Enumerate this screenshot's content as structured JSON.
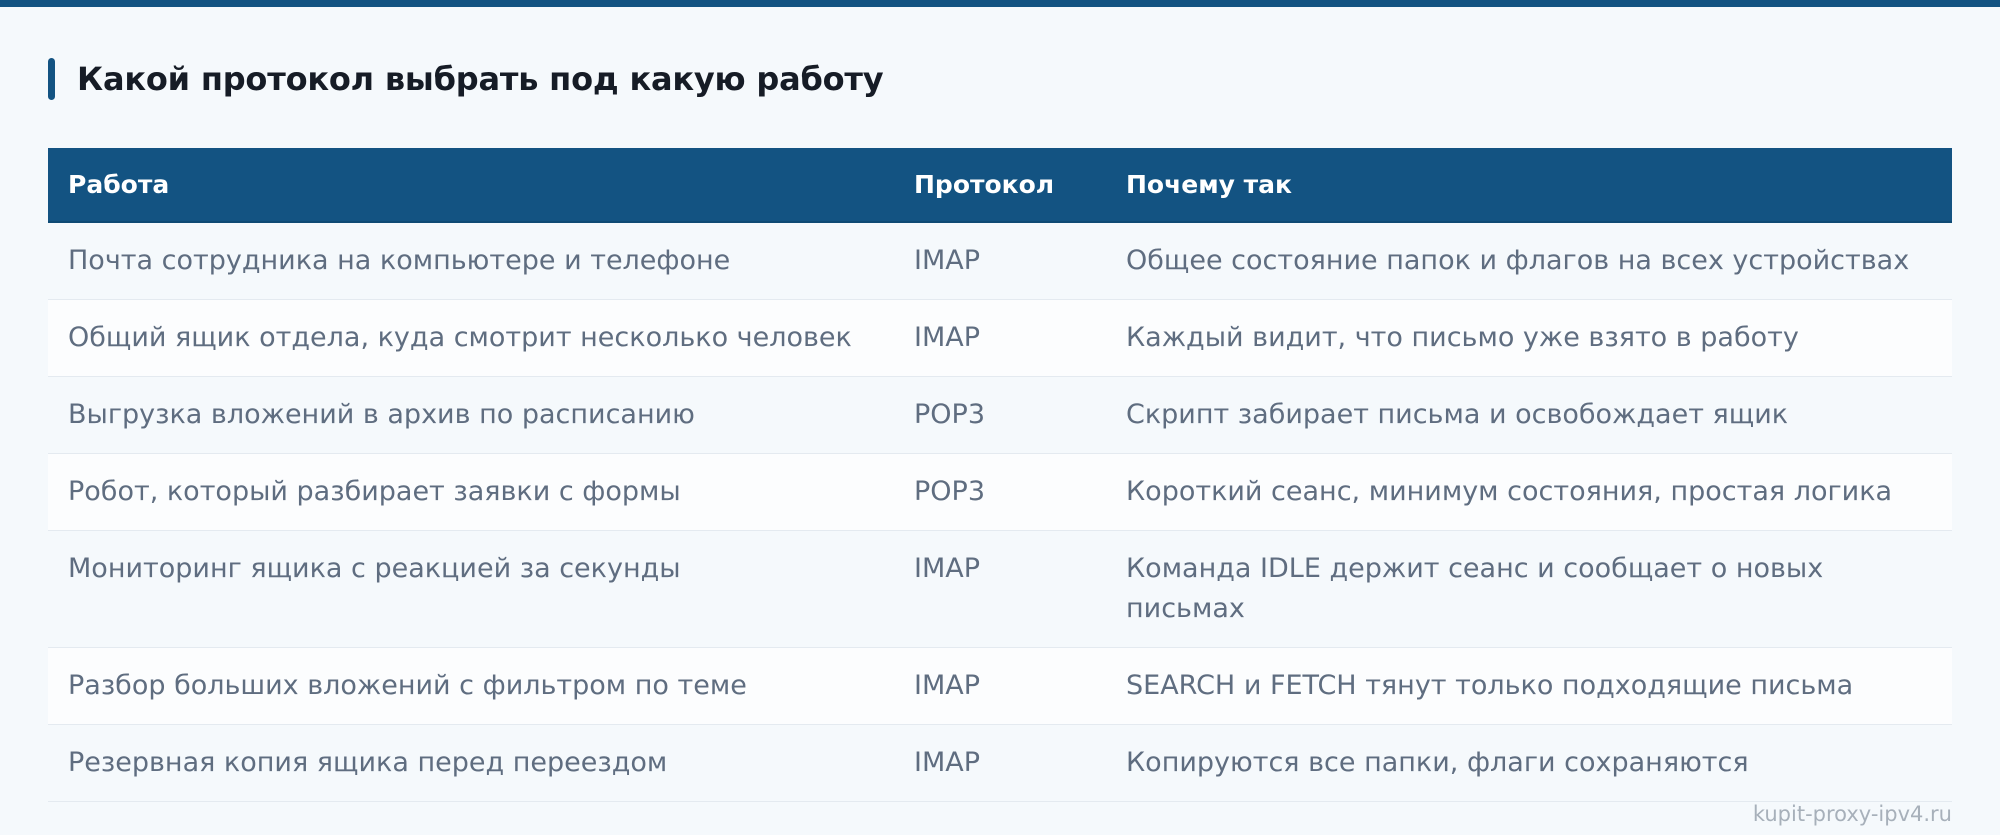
{
  "heading": "Какой протокол выбрать под какую работу",
  "table": {
    "headers": [
      "Работа",
      "Протокол",
      "Почему так"
    ],
    "rows": [
      {
        "job": "Почта сотрудника на компьютере и телефоне",
        "protocol": "IMAP",
        "reason": "Общее состояние папок и флагов на всех устройствах"
      },
      {
        "job": "Общий ящик отдела, куда смотрит несколько человек",
        "protocol": "IMAP",
        "reason": "Каждый видит, что письмо уже взято в работу"
      },
      {
        "job": "Выгрузка вложений в архив по расписанию",
        "protocol": "POP3",
        "reason": "Скрипт забирает письма и освобождает ящик"
      },
      {
        "job": "Робот, который разбирает заявки с формы",
        "protocol": "POP3",
        "reason": "Короткий сеанс, минимум состояния, простая логика"
      },
      {
        "job": "Мониторинг ящика с реакцией за секунды",
        "protocol": "IMAP",
        "reason": "Команда IDLE держит сеанс и сообщает о новых письмах"
      },
      {
        "job": "Разбор больших вложений с фильтром по теме",
        "protocol": "IMAP",
        "reason": "SEARCH и FETCH тянут только подходящие письма"
      },
      {
        "job": "Резервная копия ящика перед переездом",
        "protocol": "IMAP",
        "reason": "Копируются все папки, флаги сохраняются"
      }
    ]
  },
  "watermark": "kupit-proxy-ipv4.ru",
  "colors": {
    "accent": "#135382",
    "heading_text": "#161c26",
    "cell_text": "#5f6d80",
    "background": "#f5f9fc"
  }
}
